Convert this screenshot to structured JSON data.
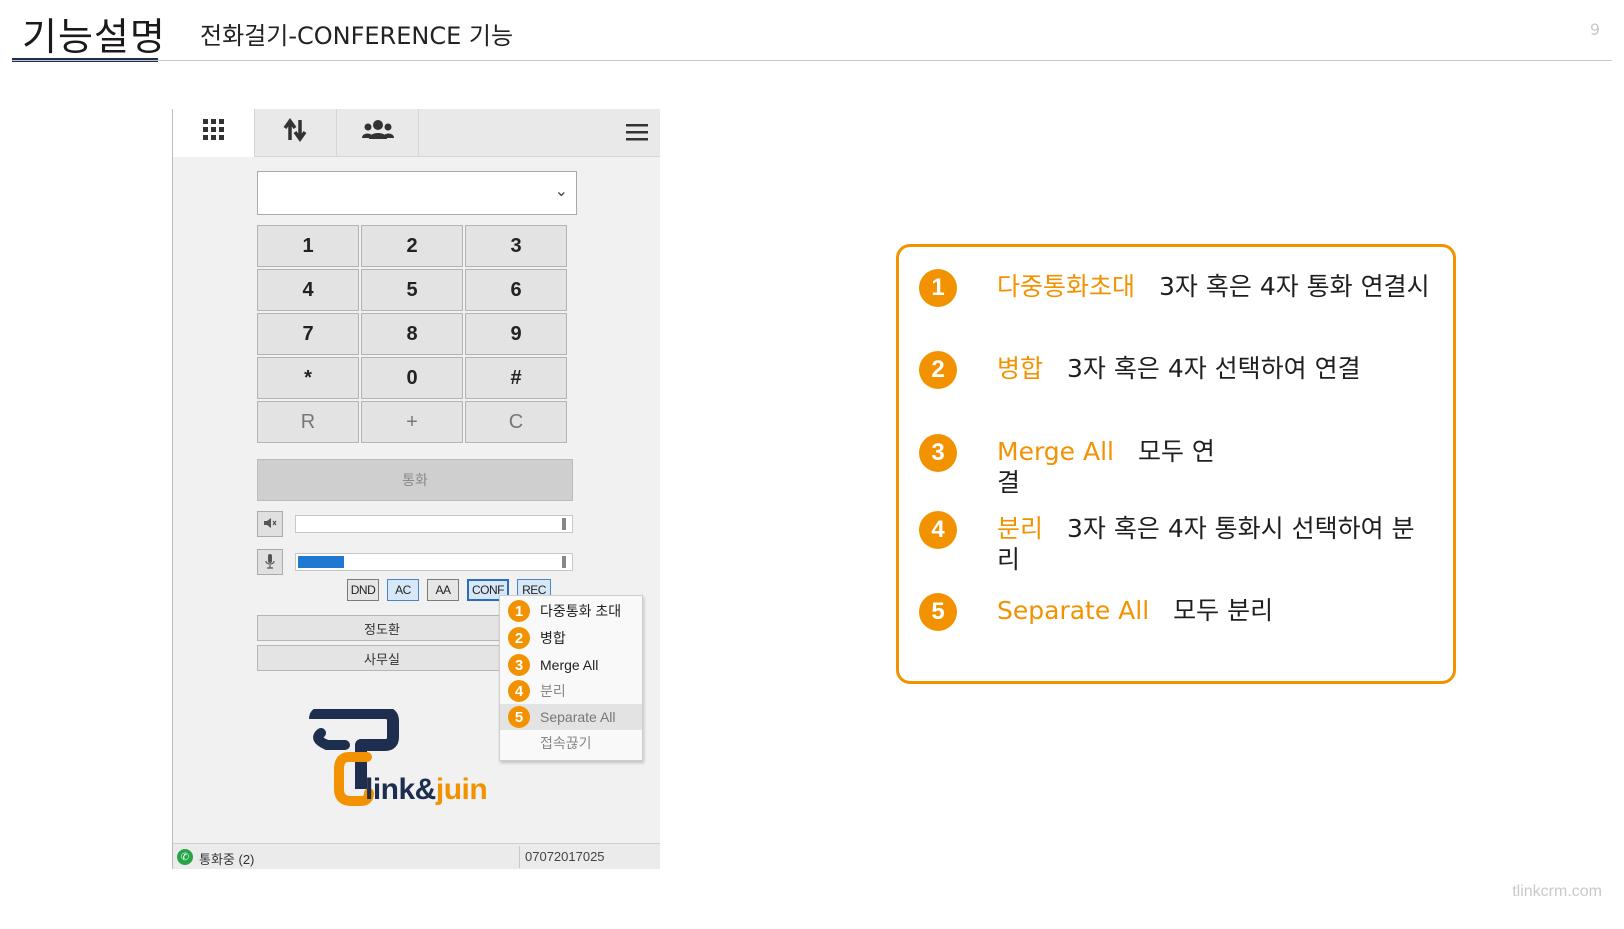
{
  "header": {
    "title": "기능설명",
    "subtitle": "전화걸기-CONFERENCE 기능",
    "page_number": "9"
  },
  "footer": {
    "site": "tlinkcrm.com"
  },
  "app": {
    "toolbar": {
      "tabs": [
        {
          "icon": "dialpad-icon"
        },
        {
          "icon": "transfer-arrows-icon"
        },
        {
          "icon": "contacts-group-icon"
        }
      ],
      "menu_icon": "hamburger-menu-icon"
    },
    "dial_input": {
      "value": ""
    },
    "keypad": [
      "1",
      "2",
      "3",
      "4",
      "5",
      "6",
      "7",
      "8",
      "9",
      "*",
      "0",
      "#",
      "R",
      "+",
      "C"
    ],
    "call_button": "통화",
    "speaker_level": 0.0,
    "mic_level": 0.17,
    "flags": [
      "DND",
      "AC",
      "AA",
      "CONF",
      "REC"
    ],
    "contacts": [
      "정도환",
      "사무실"
    ],
    "conf_menu": [
      {
        "num": "1",
        "label": "다중통화 초대"
      },
      {
        "num": "2",
        "label": "병합"
      },
      {
        "num": "3",
        "label": "Merge All"
      },
      {
        "num": "4",
        "label": "분리"
      },
      {
        "num": "5",
        "label": "Separate All"
      },
      {
        "num": "",
        "label": "접속끊기"
      }
    ],
    "logo": {
      "part1": "link&",
      "part2": "juin"
    },
    "status": {
      "text": "통화중 (2)",
      "number": "07072017025"
    }
  },
  "legend": [
    {
      "num": "1",
      "term": "다중통화초대",
      "desc": "3자 혹은 4자 통화 연결시"
    },
    {
      "num": "2",
      "term": "병합",
      "desc": "3자 혹은 4자 선택하여 연결"
    },
    {
      "num": "3",
      "term": "Merge All",
      "desc": "모두 연결"
    },
    {
      "num": "4",
      "term": "분리",
      "desc": "3자 혹은  4자 통화시 선택하여 분리"
    },
    {
      "num": "5",
      "term": "Separate All",
      "desc": "모두 분리"
    }
  ],
  "colors": {
    "accent": "#f39200",
    "navy": "#1d2e4f",
    "highlight_blue": "#1f78d1"
  }
}
